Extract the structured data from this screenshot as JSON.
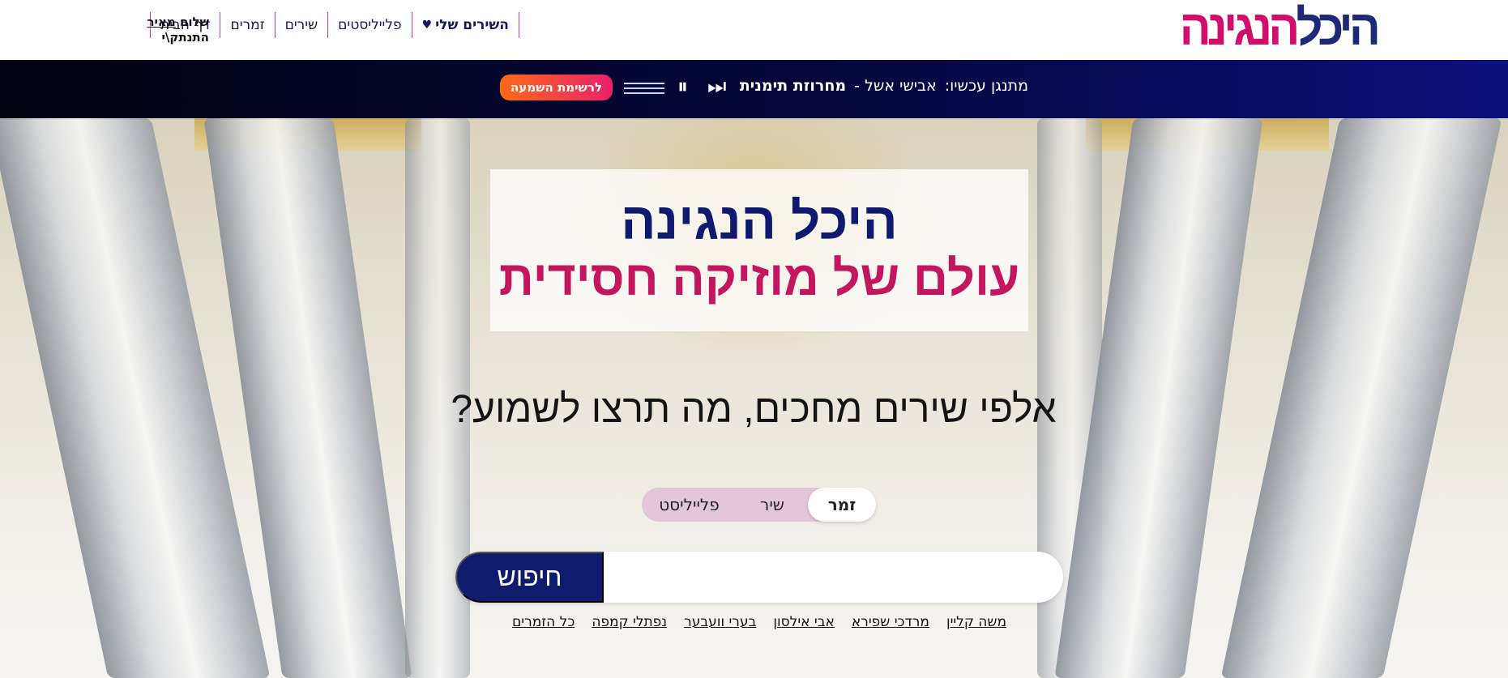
{
  "logo": {
    "part1": "היכל",
    "part2": "הנגינה"
  },
  "nav": {
    "items": [
      {
        "label": "דף הבית"
      },
      {
        "label": "זמרים"
      },
      {
        "label": "שירים"
      },
      {
        "label": "פלייליסטים"
      }
    ],
    "my_songs": "השירים שלי",
    "heart_icon": "♥"
  },
  "user": {
    "greeting": "שלום",
    "name": "מאיר",
    "logout": "התנתק\\י"
  },
  "player": {
    "now_playing_label": "מתנגן עכשיו:",
    "artist": "אבישי אשל -",
    "song": "מחרוזת תימנית",
    "skip_icon": "⏭",
    "pause_icon": "⏸",
    "listen_list_button": "לרשימת השמעה"
  },
  "hero": {
    "title": "היכל הנגינה",
    "subtitle": "עולם של מוזיקה חסידית",
    "question": "אלפי שירים מחכים, מה תרצו לשמוע?"
  },
  "search": {
    "tabs": [
      {
        "label": "זמר"
      },
      {
        "label": "שיר"
      },
      {
        "label": "פלייליסט"
      }
    ],
    "active_tab": "זמר",
    "input_value": "",
    "button": "חיפוש"
  },
  "quick_links": [
    "משה קליין",
    "מרדכי שפירא",
    "אבי אילסון",
    "בערי וועבער",
    "נפתלי קמפה",
    "כל הזמרים"
  ],
  "colors": {
    "primary": "#0f1c6e",
    "accent": "#d10e6b",
    "orange": "#ff6a1a"
  }
}
